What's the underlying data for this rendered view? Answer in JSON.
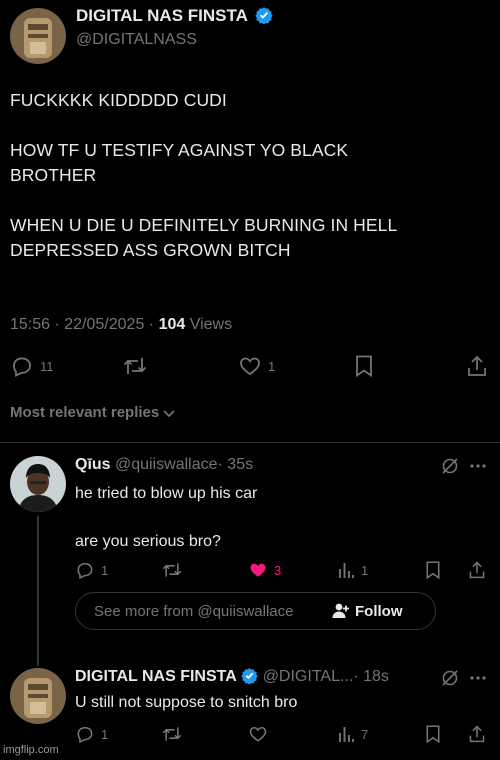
{
  "main_tweet": {
    "display_name": "DIGITAL NAS FINSTA",
    "handle": "@DIGITALNASS",
    "paragraphs": [
      "FUCKKKK KIDDDDD CUDI",
      "HOW TF U TESTIFY AGAINST YO BLACK BROTHER",
      "WHEN U DIE U DEFINITELY BURNING IN HELL DEPRESSED ASS GROWN BITCH"
    ],
    "timestamp": "15:56 · 22/05/2025 · ",
    "views_count": "104",
    "views_label": " Views",
    "reply_count": "11",
    "like_count": "1"
  },
  "replies_sort": {
    "label": "Most relevant replies"
  },
  "reply_1": {
    "display_name": "Qīus",
    "handle": "@quiiswallace",
    "time": "· 35s",
    "line1": "he tried to blow up his car",
    "line2": "are you serious bro?",
    "reply_count": "1",
    "like_count": "3",
    "view_count": "1",
    "see_more": "See more from @quiiswallace",
    "follow_label": "Follow"
  },
  "reply_2": {
    "display_name": "DIGITAL NAS FINSTA",
    "handle": "@DIGITAL...",
    "time": "· 18s",
    "text": "U still not suppose to snitch bro",
    "reply_count": "1",
    "view_count": "7"
  },
  "watermark": "imgflip.com",
  "colors": {
    "background": "#000000",
    "text": "#e7e9ea",
    "muted": "#71767b",
    "verified": "#1d9bf0",
    "like_active": "#f91880",
    "divider": "#2f3336"
  }
}
